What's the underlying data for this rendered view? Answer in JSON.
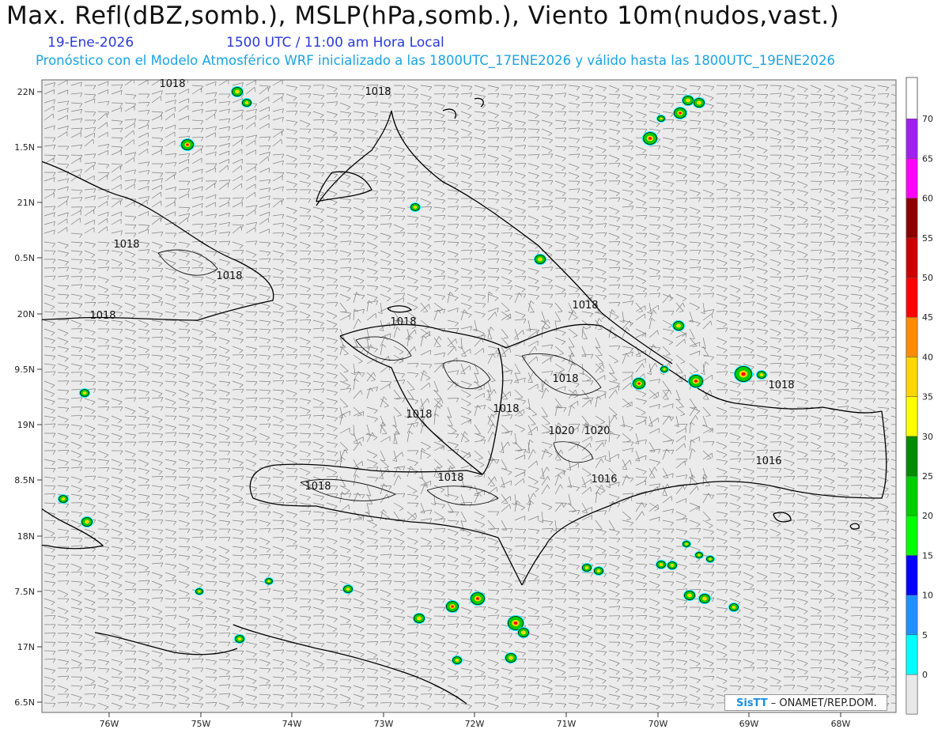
{
  "title": "Max. Refl(dBZ,somb.), MSLP(hPa,somb.), Viento 10m(nudos,vast.)",
  "date": "19-Ene-2026",
  "time": "1500 UTC / 11:00 am Hora Local",
  "model_line": "Pronóstico con el Modelo Atmosférico WRF inicializado a las 1800UTC_17ENE2026 y válido hasta las  1800UTC_19ENE2026",
  "credit": {
    "brand": "SisTT",
    "org": "ONAMET/REP.DOM."
  },
  "lat_ticks": [
    "22N",
    "1.5N",
    "21N",
    "0.5N",
    "20N",
    "9.5N",
    "19N",
    "8.5N",
    "18N",
    "7.5N",
    "17N",
    "6.5N"
  ],
  "lon_ticks": [
    "76W",
    "75W",
    "74W",
    "73W",
    "72W",
    "71W",
    "70W",
    "69W",
    "68W"
  ],
  "colorbar": {
    "labels": [
      "0",
      "5",
      "10",
      "15",
      "20",
      "25",
      "30",
      "35",
      "40",
      "45",
      "50",
      "55",
      "60",
      "65",
      "70"
    ],
    "colors": [
      "#e8e8e8",
      "#00ffff",
      "#1e90ff",
      "#0000ff",
      "#00ff00",
      "#00cd00",
      "#008b00",
      "#ffff00",
      "#ffd700",
      "#ff8c00",
      "#ff0000",
      "#cd0000",
      "#8b0000",
      "#ff00ff",
      "#a020f0"
    ]
  },
  "isobars": [
    {
      "label": "1018"
    },
    {
      "label": "1018"
    },
    {
      "label": "1018"
    },
    {
      "label": "1018"
    },
    {
      "label": "1018"
    },
    {
      "label": "1018"
    },
    {
      "label": "1018"
    },
    {
      "label": "1018"
    },
    {
      "label": "1018"
    },
    {
      "label": "1018"
    },
    {
      "label": "1018"
    },
    {
      "label": "1020"
    },
    {
      "label": "1020"
    },
    {
      "label": "1018"
    },
    {
      "label": "1018"
    },
    {
      "label": "1016"
    },
    {
      "label": "1016"
    }
  ]
}
